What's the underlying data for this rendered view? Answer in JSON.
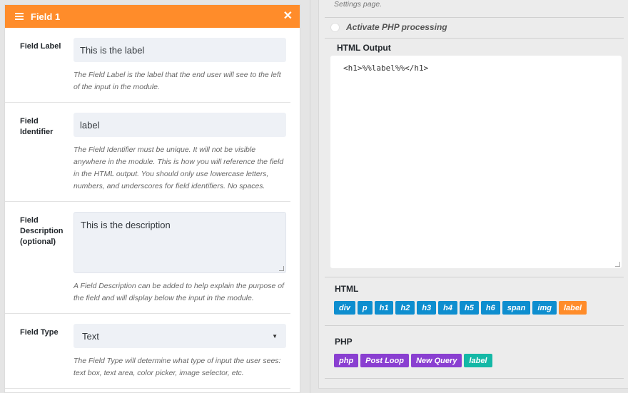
{
  "left_panel": {
    "title": "Field 1",
    "close_glyph": "✕",
    "fields": [
      {
        "label": "Field Label",
        "value": "This is the label",
        "help": "The Field Label is the label that the end user will see to the left of the input in the module."
      },
      {
        "label": "Field Identifier",
        "value": "label",
        "help": "The Field Identifier must be unique. It will not be visible anywhere in the module. This is how you will reference the field in the HTML output. You should only use lowercase letters, numbers, and underscores for field identifiers. No spaces."
      },
      {
        "label": "Field Description (optional)",
        "value": "This is the description",
        "help": "A Field Description can be added to help explain the purpose of the field and will display below the input in the module."
      },
      {
        "label": "Field Type",
        "value": "Text",
        "help": "The Field Type will determine what type of input the user sees: text box, text area, color picker, image selector, etc."
      }
    ]
  },
  "right_panel": {
    "settings_text": "Settings page.",
    "php_toggle_label": "Activate PHP processing",
    "html_output_label": "HTML Output",
    "html_output_code": "<h1>%%label%%</h1>",
    "html_section_label": "HTML",
    "html_tags": [
      "div",
      "p",
      "h1",
      "h2",
      "h3",
      "h4",
      "h5",
      "h6",
      "span",
      "img",
      "label"
    ],
    "php_section_label": "PHP",
    "php_tags": [
      "php",
      "Post Loop",
      "New Query",
      "label"
    ]
  },
  "colors": {
    "header_orange": "#ff8c2a",
    "tag_blue": "#0e8ecf",
    "tag_orange": "#ff8c2a",
    "tag_purple": "#8a3fd1",
    "tag_teal": "#14b8a6"
  }
}
